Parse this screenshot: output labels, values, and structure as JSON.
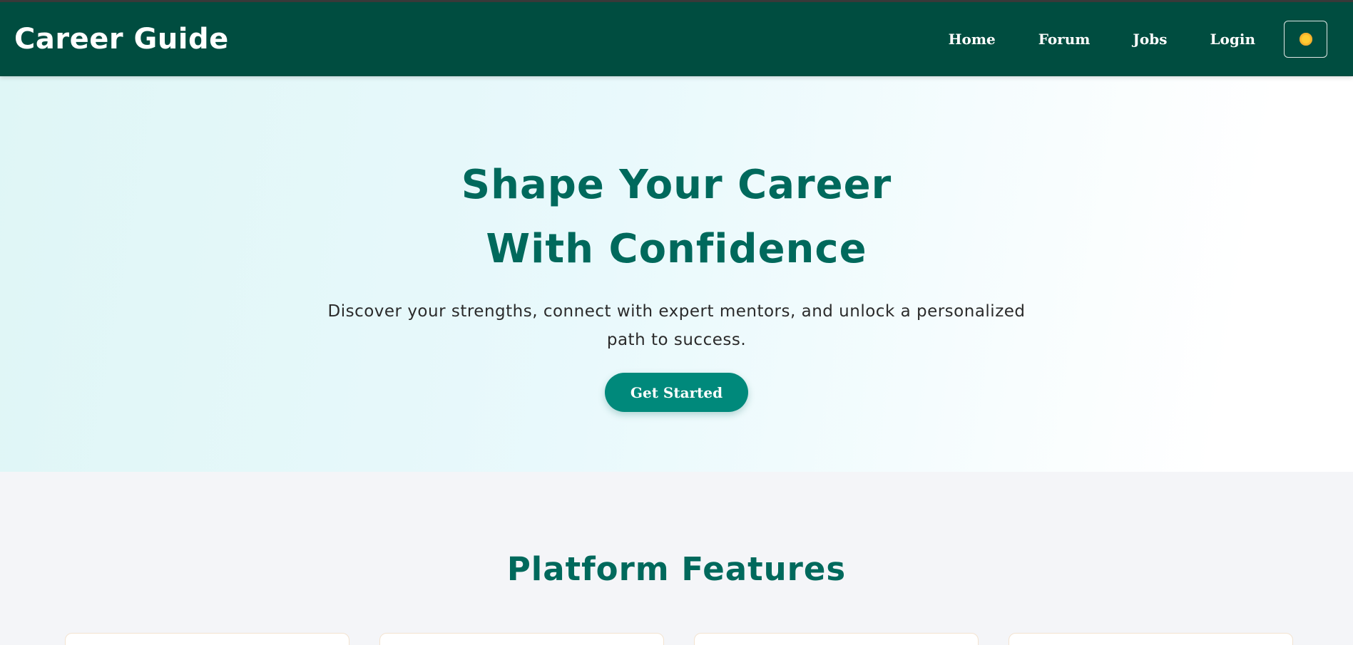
{
  "header": {
    "brand": "Career Guide",
    "nav": [
      "Home",
      "Forum",
      "Jobs",
      "Login"
    ],
    "theme_toggle_icon": "sun-icon"
  },
  "hero": {
    "title": "Shape Your Career With Confidence",
    "subtitle": "Discover your strengths, connect with expert mentors, and unlock a personalized path to success.",
    "cta_label": "Get Started"
  },
  "features": {
    "title": "Platform Features",
    "card_count_visible": 4
  },
  "colors": {
    "navbar": "#004d40",
    "accent": "#00695c",
    "button": "#00897b",
    "card_border": "#f3e3d0"
  }
}
